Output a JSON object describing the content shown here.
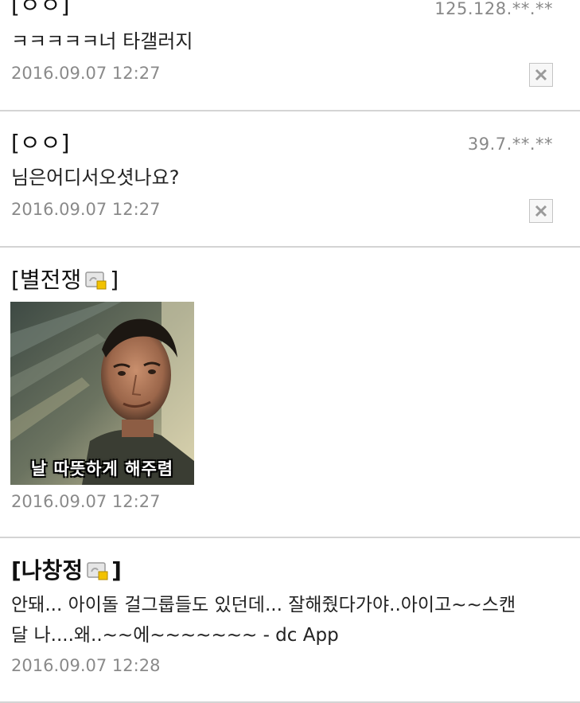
{
  "comments": [
    {
      "author": "[ㅇㅇ]",
      "ip": "125.128.**.**",
      "text": "ㅋㅋㅋㅋㅋ너 타갤러지",
      "date": "2016.09.07 12:27"
    },
    {
      "author": "[ㅇㅇ]",
      "ip": "39.7.**.**",
      "text": "님은어디서오셧나요?",
      "date": "2016.09.07 12:27"
    },
    {
      "author_open": "[별전쟁",
      "author_close": "]",
      "image_caption": "날 따뜻하게 해주렴",
      "date": "2016.09.07 12:27"
    },
    {
      "author_open": "[나창정",
      "author_close": "]",
      "text_line1": "안돼... 아이돌 걸그룹들도 있던데... 잘해줬다가야..아이고~~스캔",
      "text_line2": "달 나....왜..~~에~~~~~~~ - dc App",
      "date": "2016.09.07 12:28"
    }
  ],
  "icons": {
    "delete": "close-x-icon",
    "gallog": "gallery-user-icon"
  },
  "colors": {
    "divider": "#d4d4d4",
    "meta_text": "#8a8a8a",
    "icon_badge": "#f2c200"
  }
}
